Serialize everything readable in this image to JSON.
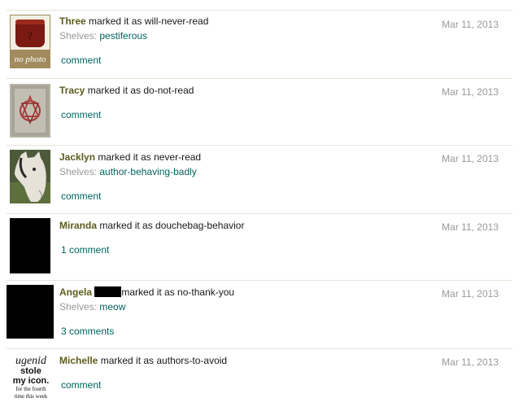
{
  "feed": {
    "items": [
      {
        "user": "Three",
        "action": " marked it as will-never-read",
        "shelves_label": "Shelves:",
        "shelf": "pestiferous",
        "comment": "comment",
        "date": "Mar 11, 2013",
        "avatar_text": "no photo"
      },
      {
        "user": "Tracy",
        "action": " marked it as do-not-read",
        "comment": "comment",
        "date": "Mar 11, 2013"
      },
      {
        "user": "Jacklyn",
        "action": " marked it as never-read",
        "shelves_label": "Shelves:",
        "shelf": "author-behaving-badly",
        "comment": "comment",
        "date": "Mar 11, 2013"
      },
      {
        "user": "Miranda",
        "action": " marked it as douchebag-behavior",
        "comment": "1 comment",
        "date": "Mar 11, 2013"
      },
      {
        "user": "Angela",
        "action": "marked it as no-thank-you",
        "shelves_label": "Shelves:",
        "shelf": "meow",
        "comment": "3 comments",
        "date": "Mar 11, 2013"
      },
      {
        "user": "Michelle",
        "action": " marked it as authors-to-avoid",
        "comment": "comment",
        "date": "Mar 11, 2013",
        "avatar_text": [
          "ugenid",
          "stole",
          "my icon.",
          "for the fourth",
          "time this week"
        ]
      }
    ]
  },
  "colors": {
    "username": "#5c5c1c",
    "link": "#00635d",
    "muted": "#999999",
    "divider": "#e6e4d8",
    "no_photo_bg": "#a28b5f",
    "no_photo_book": "#7a1a12"
  }
}
